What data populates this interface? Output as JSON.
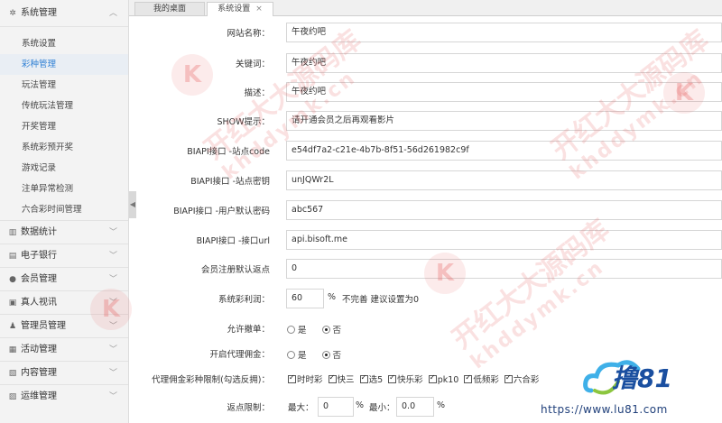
{
  "sidebar": {
    "groups": [
      {
        "label": "系统管理",
        "icon": "gear-icon",
        "items": [
          "系统设置",
          "彩种管理",
          "玩法管理",
          "传统玩法管理",
          "开奖管理",
          "系统彩预开奖",
          "游戏记录",
          "注单异常检测",
          "六合彩时间管理"
        ],
        "active": 1
      },
      {
        "label": "数据统计",
        "icon": "chart-icon"
      },
      {
        "label": "电子银行",
        "icon": "bank-icon"
      },
      {
        "label": "会员管理",
        "icon": "user-icon"
      },
      {
        "label": "真人视讯",
        "icon": "video-icon"
      },
      {
        "label": "管理员管理",
        "icon": "admin-icon"
      },
      {
        "label": "活动管理",
        "icon": "gift-icon"
      },
      {
        "label": "内容管理",
        "icon": "content-icon"
      },
      {
        "label": "运维管理",
        "icon": "ops-icon"
      }
    ]
  },
  "tabs": [
    {
      "label": "我的桌面"
    },
    {
      "label": "系统设置",
      "close": "×"
    }
  ],
  "form": {
    "site_name": {
      "label": "网站名称：",
      "value": "午夜约吧"
    },
    "keywords": {
      "label": "关键词：",
      "value": "午夜约吧"
    },
    "description": {
      "label": "描述：",
      "value": "午夜约吧"
    },
    "show_tip": {
      "label": "SHOW提示：",
      "value": "请开通会员之后再观看影片"
    },
    "biapi_code": {
      "label": "BIAPI接口 -站点code",
      "value": "e54df7a2-c21e-4b7b-8f51-56d261982c9f"
    },
    "biapi_key": {
      "label": "BIAPI接口 -站点密钥",
      "value": "unJQWr2L"
    },
    "biapi_pwd": {
      "label": "BIAPI接口 -用户默认密码",
      "value": "abc567"
    },
    "biapi_url": {
      "label": "BIAPI接口 -接口url",
      "value": "api.bisoft.me"
    },
    "rebate": {
      "label": "会员注册默认返点",
      "value": "0"
    },
    "profit": {
      "label": "系统彩利润：",
      "value": "60",
      "unit": "%",
      "note": "不完善 建议设置为0"
    },
    "allow_cancel": {
      "label": "允许撤单：",
      "yes": "是",
      "no": "否",
      "selected": "no"
    },
    "agent_commission": {
      "label": "开启代理佣金：",
      "yes": "是",
      "no": "否",
      "selected": "no"
    },
    "agent_limit": {
      "label": "代理佣金彩种限制(勾选反拥)：",
      "options": [
        "时时彩",
        "快三",
        "选5",
        "快乐彩",
        "pk10",
        "低频彩",
        "六合彩"
      ]
    },
    "rebate_limit": {
      "label": "返点限制：",
      "max_label": "最大：",
      "max_value": "0",
      "max_unit": "%",
      "min_label": "最小：",
      "min_value": "0.0",
      "min_unit": "%"
    }
  },
  "watermark": {
    "text": "开红大大源码库",
    "url": "khddymk.cn",
    "badge": "K"
  },
  "logo": {
    "text": "撸81",
    "url": "https://www.lu81.com"
  },
  "colors": {
    "accent": "#2d7fd4",
    "logo": "#1a4fa0",
    "watermark": "#e65a5a"
  }
}
